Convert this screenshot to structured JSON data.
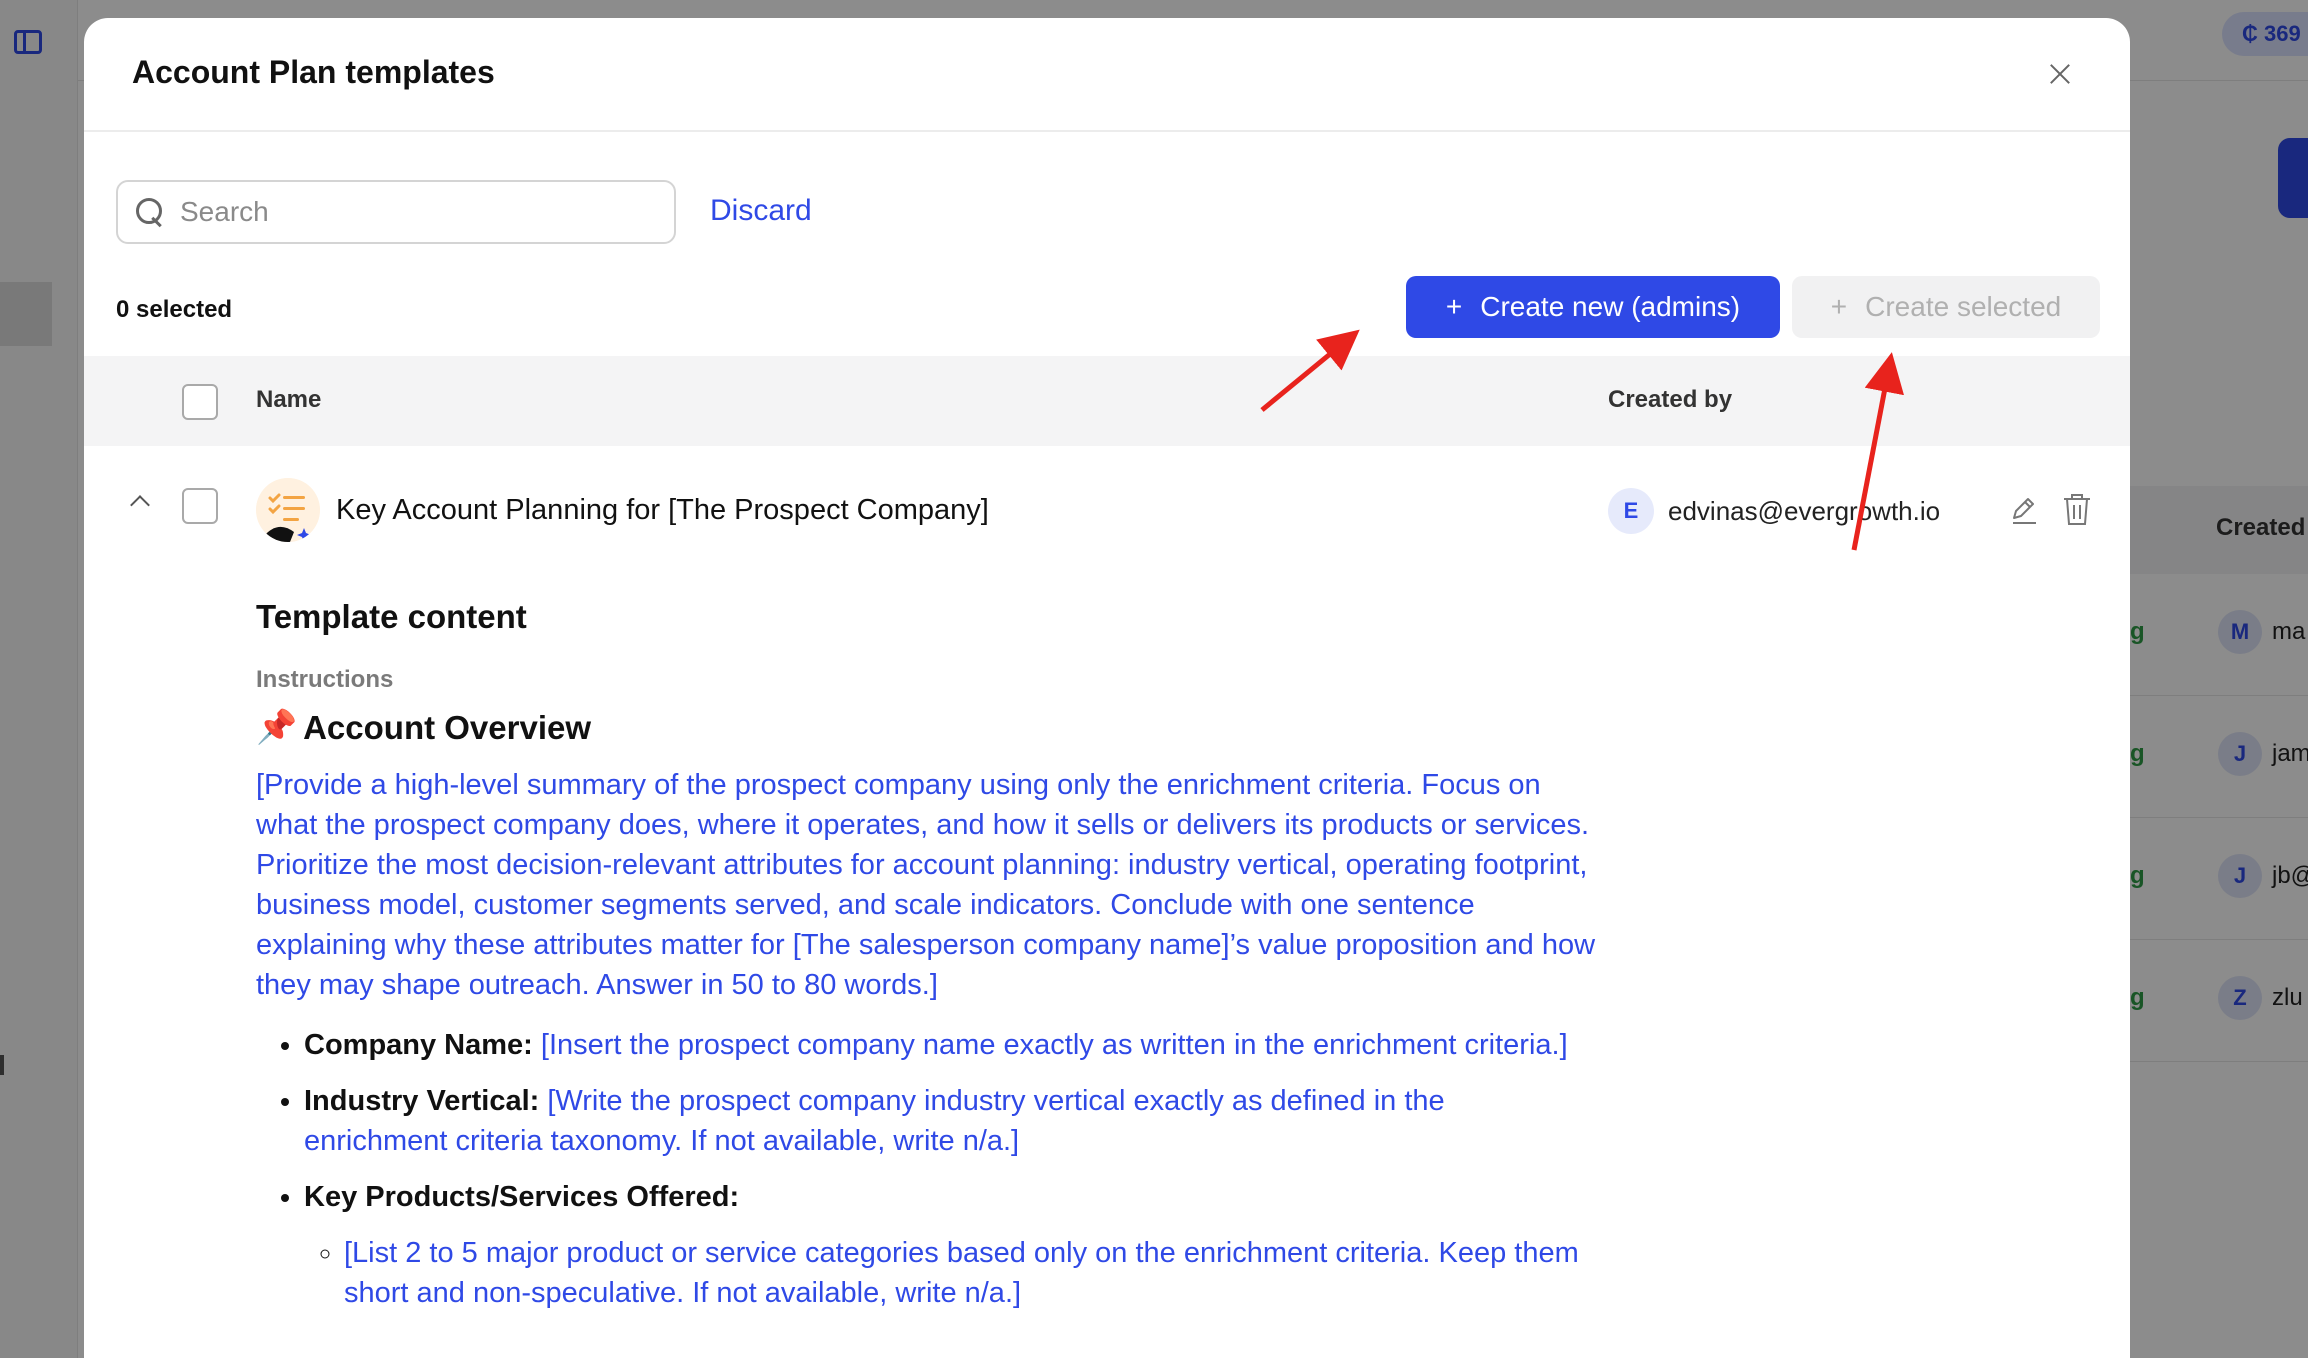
{
  "background": {
    "credits": "₵ 369",
    "column_header": "Created",
    "rows": [
      {
        "status": "g",
        "avatar": "M",
        "email": "ma"
      },
      {
        "status": "g",
        "avatar": "J",
        "email": "jam"
      },
      {
        "status": "g",
        "avatar": "J",
        "email": "jb@"
      },
      {
        "status": "g",
        "avatar": "Z",
        "email": "zlu"
      }
    ]
  },
  "modal": {
    "title": "Account Plan templates",
    "search": {
      "placeholder": "Search",
      "value": ""
    },
    "discard_label": "Discard",
    "selected_count": "0 selected",
    "create_new_label": "Create new (admins)",
    "create_selected_label": "Create selected",
    "table": {
      "columns": {
        "name": "Name",
        "created_by": "Created by"
      },
      "rows": [
        {
          "title": "Key Account Planning for [The Prospect Company]",
          "creator_initial": "E",
          "creator_email": "edvinas@evergrowth.io"
        }
      ]
    },
    "content": {
      "heading": "Template content",
      "label": "Instructions",
      "section_emoji": "📌",
      "section_title": "Account Overview",
      "paragraph": "[Provide a high-level summary of the prospect company using only the enrichment criteria. Focus on what the prospect company does, where it operates, and how it sells or delivers its products or services. Prioritize the most decision-relevant attributes for account planning: industry vertical, operating footprint, business model, customer segments served, and scale indicators. Conclude with one sentence explaining why these attributes matter for [The salesperson company name]’s value proposition and how they may shape outreach. Answer in 50 to 80 words.]",
      "bullets": [
        {
          "label": "Company Name:",
          "text": "[Insert the prospect company name exactly as written in the enrichment criteria.]"
        },
        {
          "label": "Industry Vertical:",
          "text": "[Write the prospect company industry vertical exactly as defined in the enrichment criteria taxonomy. If not available, write n/a.]"
        },
        {
          "label": "Key Products/Services Offered:",
          "text": ""
        }
      ],
      "sub_bullets": [
        {
          "text": "[List 2 to 5 major product or service categories based only on the enrichment criteria. Keep them short and non-speculative. If not available, write n/a.]"
        }
      ]
    }
  },
  "colors": {
    "accent": "#2f49e6",
    "annotation": "#e8231d"
  }
}
